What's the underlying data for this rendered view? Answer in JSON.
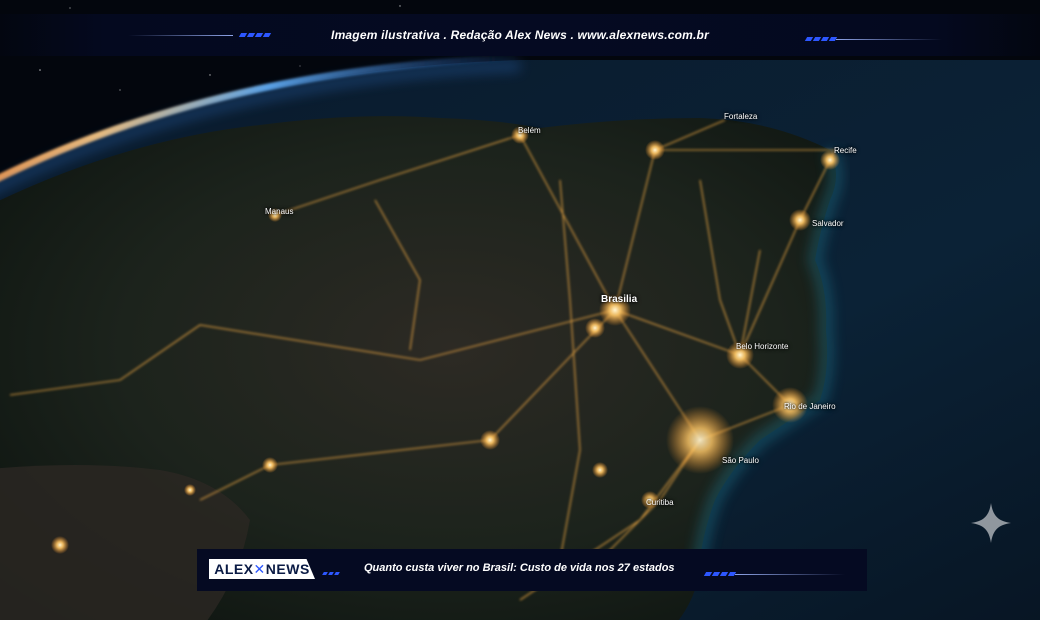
{
  "top_banner": {
    "caption": "Imagem ilustrativa . Redação Alex News . www.alexnews.com.br"
  },
  "bottom_banner": {
    "logo": {
      "part1": "ALEX",
      "part2": "NEWS"
    },
    "caption": "Quanto custa viver no Brasil: Custo de vida nos 27 estados"
  },
  "cities": {
    "belem": "Belém",
    "fortaleza": "Fortaleza",
    "recife": "Recife",
    "manaus": "Manaus",
    "salvador": "Salvador",
    "brasilia": "Brasilia",
    "belo_horizonte": "Belo Horizonte",
    "rio_de_janeiro": "Rio de Janeiro",
    "sao_paulo": "São Paulo",
    "curitiba": "Curitiba"
  },
  "colors": {
    "banner_bg": "#050a22",
    "accent": "#2d57ff",
    "city_lights": "#ffc766",
    "ocean": "#123a52"
  }
}
